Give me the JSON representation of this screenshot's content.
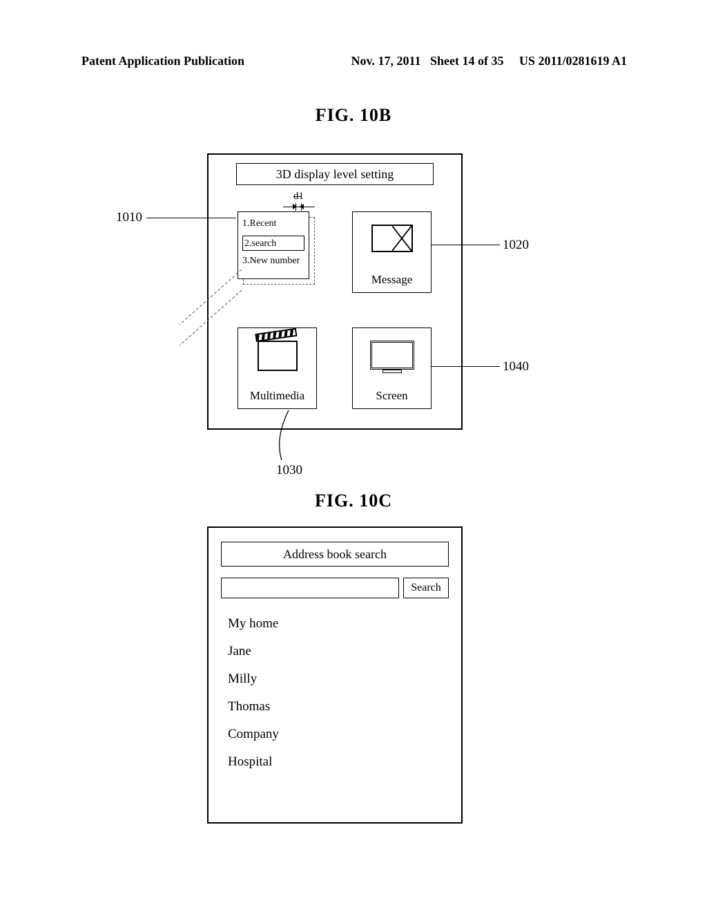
{
  "header": {
    "left": "Patent Application Publication",
    "date": "Nov. 17, 2011",
    "sheet": "Sheet 14 of 35",
    "pubno": "US 2011/0281619 A1"
  },
  "fig10b": {
    "label": "FIG. 10B",
    "title": "3D display level setting",
    "d1": "d1",
    "menu": {
      "item1": "1.Recent",
      "item2": "2.search",
      "item3": "3.New number"
    },
    "tiles": {
      "message": "Message",
      "multimedia": "Multimedia",
      "screen": "Screen"
    },
    "refs": {
      "r1010": "1010",
      "r1020": "1020",
      "r1030": "1030",
      "r1040": "1040"
    }
  },
  "fig10c": {
    "label": "FIG. 10C",
    "title": "Address book search",
    "search_btn": "Search",
    "contacts": [
      "My home",
      "Jane",
      "Milly",
      "Thomas",
      "Company",
      "Hospital"
    ]
  }
}
